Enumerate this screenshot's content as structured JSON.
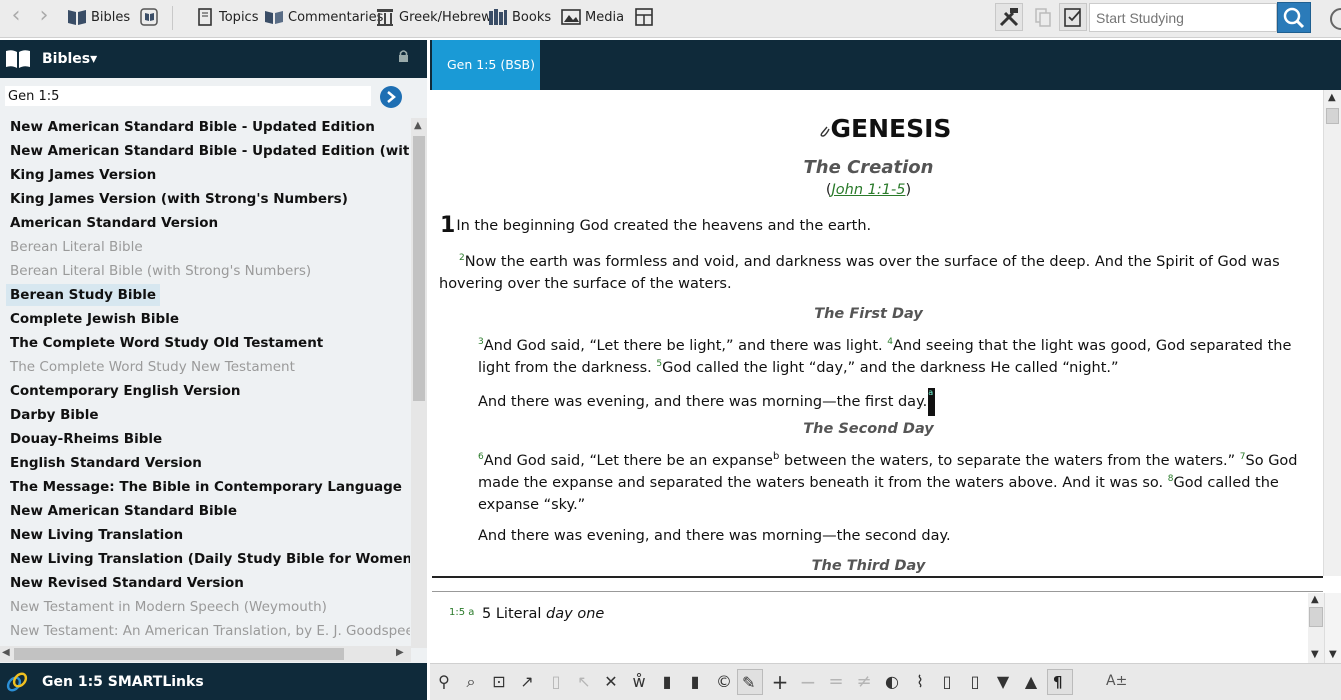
{
  "toolbar": {
    "back_arrow": "‹",
    "forward_arrow": "›",
    "bibles": "Bibles",
    "topics": "Topics",
    "commentaries": "Commentaries",
    "greek_hebrew": "Greek/Hebrew",
    "books": "Books",
    "media": "Media",
    "search_placeholder": "Start Studying"
  },
  "left_panel": {
    "title": "Bibles▾",
    "reference_value": "Gen 1:5",
    "bibles": [
      {
        "label": "New American Standard Bible - Updated Edition",
        "state": "normal"
      },
      {
        "label": "New American Standard Bible - Updated Edition (with Strong's Numbers)",
        "state": "normal"
      },
      {
        "label": "King James Version",
        "state": "normal"
      },
      {
        "label": "King James Version (with Strong's Numbers)",
        "state": "normal"
      },
      {
        "label": "American Standard Version",
        "state": "normal"
      },
      {
        "label": "Berean Literal Bible",
        "state": "dim"
      },
      {
        "label": "Berean Literal Bible (with Strong's Numbers)",
        "state": "dim"
      },
      {
        "label": "Berean Study Bible",
        "state": "selected"
      },
      {
        "label": "Complete Jewish Bible",
        "state": "normal"
      },
      {
        "label": "The Complete Word Study Old Testament",
        "state": "normal"
      },
      {
        "label": "The Complete Word Study New Testament",
        "state": "dim"
      },
      {
        "label": "Contemporary English Version",
        "state": "normal"
      },
      {
        "label": "Darby Bible",
        "state": "normal"
      },
      {
        "label": "Douay-Rheims Bible",
        "state": "normal"
      },
      {
        "label": "English Standard Version",
        "state": "normal"
      },
      {
        "label": "The Message: The Bible in Contemporary Language",
        "state": "normal"
      },
      {
        "label": "New American Standard Bible",
        "state": "normal"
      },
      {
        "label": "New Living Translation",
        "state": "normal"
      },
      {
        "label": "New Living Translation (Daily Study Bible for Women)",
        "state": "normal"
      },
      {
        "label": "New Revised Standard Version",
        "state": "normal"
      },
      {
        "label": "New Testament in Modern Speech (Weymouth)",
        "state": "dim"
      },
      {
        "label": "New Testament: An American Translation, by E. J. Goodspeed",
        "state": "dim"
      }
    ],
    "footer": "Gen 1:5 SMARTLinks"
  },
  "reader": {
    "tab_label": "Gen 1:5 (BSB)",
    "book_title": "GENESIS",
    "section_creation": "The Creation",
    "creation_ref_open": "(",
    "creation_ref_link": "John 1:1-5",
    "creation_ref_close": ")",
    "chapter_number": "1",
    "v1": "In the beginning God created the heavens and the earth.",
    "v2_num": "2",
    "v2": "Now the earth was formless and void, and darkness was over the surface of the deep. And the Spirit of God was hovering over the surface of the waters.",
    "section_first_day": "The First Day",
    "v3_num": "3",
    "v3": "And God said, “Let there be light,” and there was light. ",
    "v4_num": "4",
    "v4": "And seeing that the light was good, God separated the light from the darkness. ",
    "v5_num": "5",
    "v5": "God called the light “day,” and the darkness He called “night.”",
    "v5b": "And there was evening, and there was morning—the first day.",
    "v5b_fn": "a",
    "section_second_day": "The Second Day",
    "v6_num": "6",
    "v6a": "And God said, “Let there be an expanse",
    "v6_fn": "b",
    "v6b": " between the waters, to separate the waters from the waters.” ",
    "v7_num": "7",
    "v7": "So God made the expanse and separated the waters beneath it from the waters above. And it was so. ",
    "v8_num": "8",
    "v8": "God called the expanse “sky.”",
    "v8b": "And there was evening, and there was morning—the second day.",
    "section_third_day": "The Third Day"
  },
  "note": {
    "ref": "1:5 a",
    "text_plain": "5 Literal ",
    "text_italic": "day one"
  },
  "colors": {
    "dark_header": "#0f2a3a",
    "tab_active": "#1a9ad6",
    "verse_number": "#2a7a2a",
    "selected_item": "#d7e7f0"
  }
}
